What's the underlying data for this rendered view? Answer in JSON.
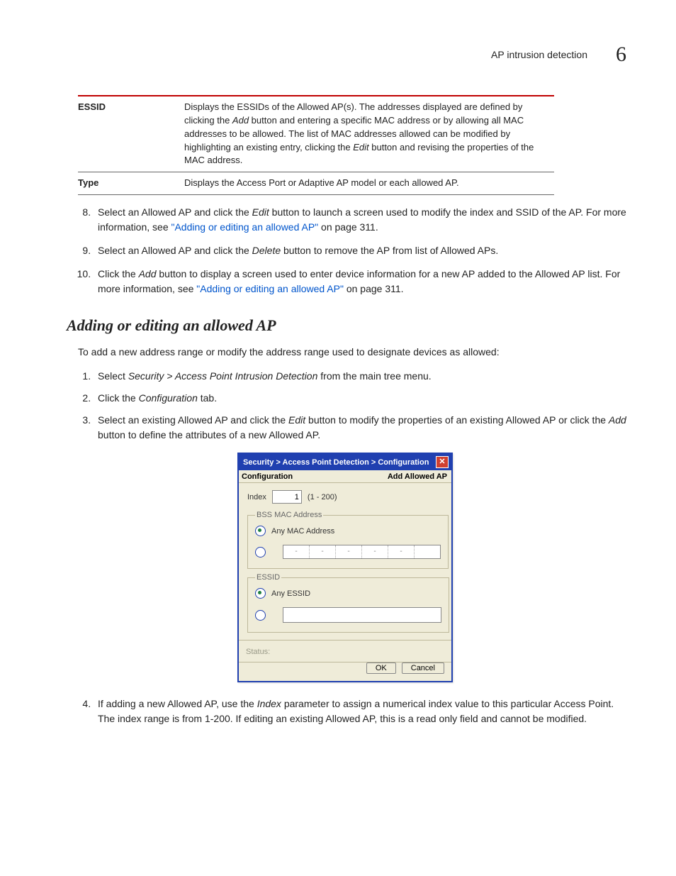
{
  "header": {
    "title": "AP intrusion detection",
    "chapter_number": "6"
  },
  "param_table": {
    "rows": [
      {
        "label": "ESSID",
        "desc_parts": {
          "p1": "Displays the ESSIDs of the Allowed AP(s). The addresses displayed are defined by clicking the ",
          "i1": "Add",
          "p2": " button and entering a specific MAC address or by allowing all MAC addresses to be allowed. The list of MAC addresses allowed can be modified by highlighting an existing entry, clicking the ",
          "i2": "Edit",
          "p3": " button and revising the properties of the MAC address."
        }
      },
      {
        "label": "Type",
        "desc": "Displays the Access Port or Adaptive AP model or each allowed AP."
      }
    ]
  },
  "steps_a": [
    {
      "p1": "Select an Allowed AP and click the ",
      "i1": "Edit",
      "p2": " button to launch a screen used to modify the index and SSID of the AP. For more information, see ",
      "link": "\"Adding or editing an allowed AP\"",
      "p3": " on page 311."
    },
    {
      "p1": "Select an Allowed AP and click the ",
      "i1": "Delete",
      "p2": " button to remove the AP from list of Allowed APs."
    },
    {
      "p1": "Click the ",
      "i1": "Add",
      "p2": " button to display a screen used to enter device information for a new AP added to the Allowed AP list. For more information, see ",
      "link": "\"Adding or editing an allowed AP\"",
      "p3": " on page 311."
    }
  ],
  "section_heading": "Adding or editing an allowed AP",
  "intro_line": "To add a new address range or modify the address range used to designate devices as allowed:",
  "steps_b": [
    {
      "p1": "Select ",
      "i1": "Security > Access Point Intrusion Detection",
      "p2": " from the main tree menu."
    },
    {
      "p1": "Click the ",
      "i1": "Configuration",
      "p2": " tab."
    },
    {
      "p1": "Select an existing Allowed AP and click the ",
      "i1": "Edit",
      "p2": " button to modify the properties of an existing Allowed AP or click the ",
      "i2": "Add",
      "p3": " button to define the attributes of a new Allowed AP."
    }
  ],
  "dialog": {
    "title": "Security > Access Point Detection > Configuration",
    "left_label": "Configuration",
    "right_label": "Add Allowed AP",
    "index_label": "Index",
    "index_value": "1",
    "index_range": "(1 - 200)",
    "fs_bss_legend": "BSS MAC Address",
    "bss_any_label": "Any MAC Address",
    "fs_essid_legend": "ESSID",
    "essid_any_label": "Any ESSID",
    "status_label": "Status:",
    "ok_label": "OK",
    "cancel_label": "Cancel"
  },
  "step4": {
    "p1": "If adding a new Allowed AP, use the ",
    "i1": "Index",
    "p2": " parameter to assign a numerical index value to this particular Access Point. The index range is from 1-200. If editing an existing Allowed AP, this is a read only field and cannot be modified."
  }
}
